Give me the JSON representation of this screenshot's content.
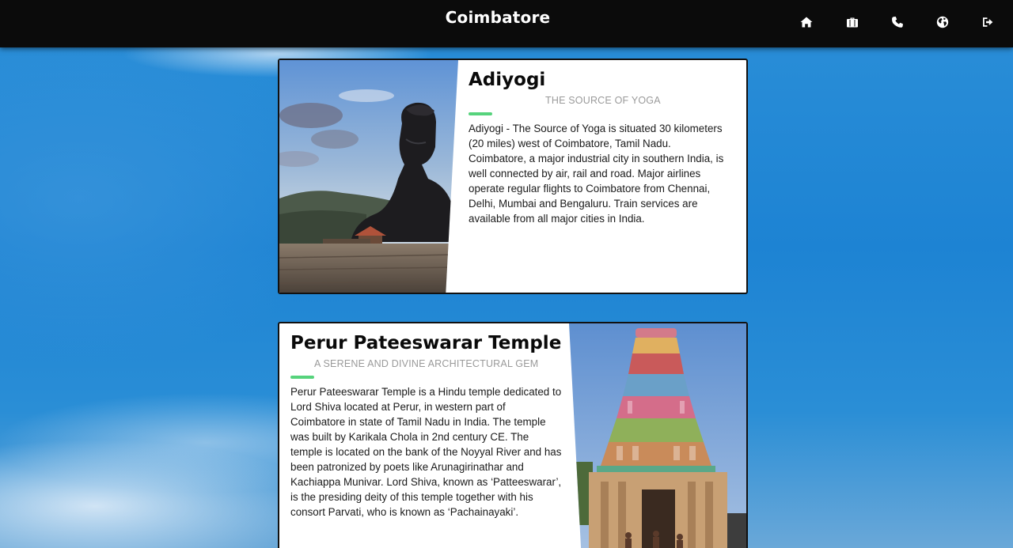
{
  "header": {
    "title": "Coimbatore",
    "nav": [
      {
        "icon": "home-icon",
        "label": "Home"
      },
      {
        "icon": "briefcase-icon",
        "label": "Services"
      },
      {
        "icon": "phone-icon",
        "label": "Contact"
      },
      {
        "icon": "globe-icon",
        "label": "Explore"
      },
      {
        "icon": "sign-out-icon",
        "label": "Logout"
      }
    ]
  },
  "cards": [
    {
      "title": "Adiyogi",
      "subtitle": "THE SOURCE OF YOGA",
      "body": "Adiyogi - The Source of Yoga is situated 30 kilometers (20 miles) west of Coimbatore, Tamil Nadu. Coimbatore, a major industrial city in southern India, is well connected by air, rail and road. Major airlines operate regular flights to Coimbatore from Chennai, Delhi, Mumbai and Bengaluru. Train services are available from all major cities in India."
    },
    {
      "title": "Perur Pateeswarar Temple",
      "subtitle": "A SERENE AND DIVINE ARCHITECTURAL GEM",
      "body": "Perur Pateeswarar Temple is a Hindu temple dedicated to Lord Shiva located at Perur, in western part of Coimbatore in state of Tamil Nadu in India. The temple was built by Karikala Chola in 2nd century CE. The temple is located on the bank of the Noyyal River and has been patronized by poets like Arunagirinathar and Kachiappa Munivar. Lord Shiva, known as ‘Patteeswarar’, is the presiding deity of this temple together with his consort Parvati, who is known as ‘Pachainayaki’."
    }
  ],
  "colors": {
    "header_bg": "#0b0b0b",
    "accent": "#56d37c",
    "subtitle": "#9a9a9a"
  }
}
